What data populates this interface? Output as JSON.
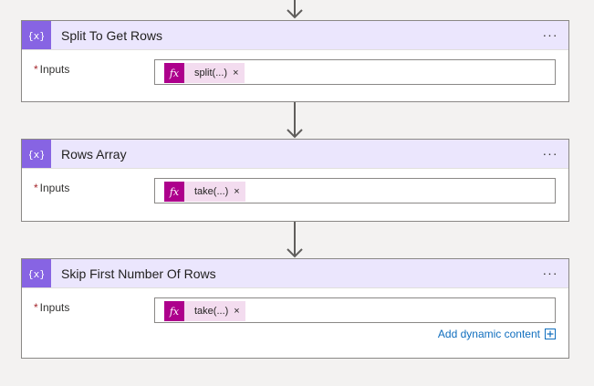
{
  "steps": [
    {
      "title": "Split To Get Rows",
      "icon": "variable-braces-icon",
      "more_label": "···",
      "field": {
        "required_marker": "*",
        "label": "Inputs",
        "token_label": "split(...)",
        "token_icon_text": "fx",
        "remove_label": "×"
      }
    },
    {
      "title": "Rows Array",
      "icon": "variable-braces-icon",
      "more_label": "···",
      "field": {
        "required_marker": "*",
        "label": "Inputs",
        "token_label": "take(...)",
        "token_icon_text": "fx",
        "remove_label": "×"
      }
    },
    {
      "title": "Skip First Number Of Rows",
      "icon": "variable-braces-icon",
      "more_label": "···",
      "field": {
        "required_marker": "*",
        "label": "Inputs",
        "token_label": "take(...)",
        "token_icon_text": "fx",
        "remove_label": "×"
      },
      "dynamic_content_label": "Add dynamic content"
    }
  ],
  "colors": {
    "header_bg": "#ebe6fd",
    "icon_bg": "#8764e3",
    "token_icon_bg": "#ad008c",
    "token_bg": "#f3dcef",
    "link": "#106ebe",
    "required": "#a4262c"
  }
}
